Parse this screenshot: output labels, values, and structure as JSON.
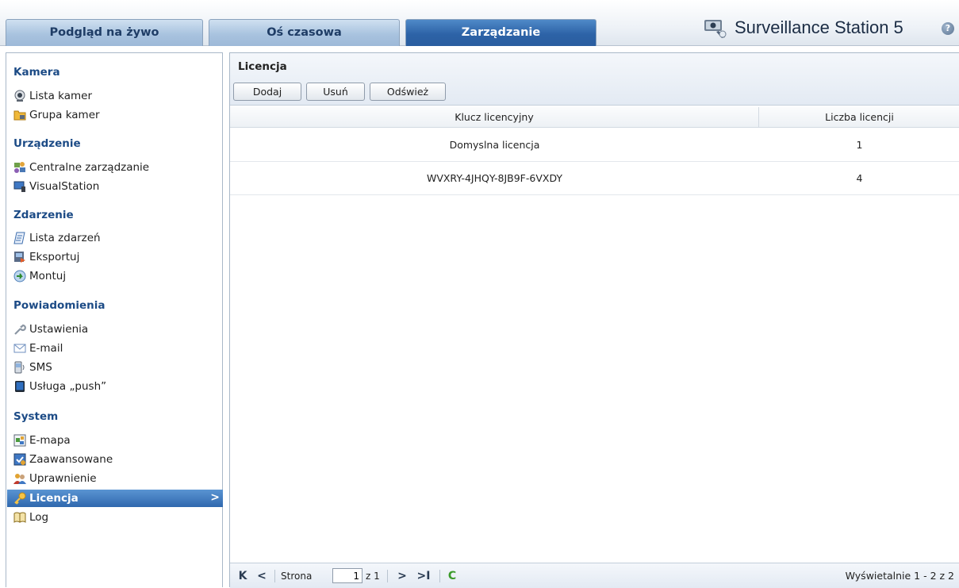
{
  "tabs": [
    {
      "label": "Podgląd na żywo",
      "active": false
    },
    {
      "label": "Oś czasowa",
      "active": false
    },
    {
      "label": "Zarządzanie",
      "active": true
    }
  ],
  "brand": {
    "title": "Surveillance Station 5",
    "logo_icon": "camera-logo-icon",
    "help_icon": "help-icon"
  },
  "sidebar": {
    "sections": [
      {
        "title": "Kamera",
        "items": [
          {
            "label": "Lista kamer",
            "icon": "camera-icon"
          },
          {
            "label": "Grupa kamer",
            "icon": "camera-group-icon"
          }
        ]
      },
      {
        "title": "Urządzenie",
        "items": [
          {
            "label": "Centralne zarządzanie",
            "icon": "central-management-icon"
          },
          {
            "label": "VisualStation",
            "icon": "visualstation-icon"
          }
        ]
      },
      {
        "title": "Zdarzenie",
        "items": [
          {
            "label": "Lista zdarzeń",
            "icon": "event-list-icon"
          },
          {
            "label": "Eksportuj",
            "icon": "export-icon"
          },
          {
            "label": "Montuj",
            "icon": "mount-icon"
          }
        ]
      },
      {
        "title": "Powiadomienia",
        "items": [
          {
            "label": "Ustawienia",
            "icon": "wrench-icon"
          },
          {
            "label": "E-mail",
            "icon": "email-icon"
          },
          {
            "label": "SMS",
            "icon": "sms-icon"
          },
          {
            "label": "Usługa „push”",
            "icon": "push-device-icon"
          }
        ]
      },
      {
        "title": "System",
        "items": [
          {
            "label": "E-mapa",
            "icon": "emap-icon"
          },
          {
            "label": "Zaawansowane",
            "icon": "advanced-icon"
          },
          {
            "label": "Uprawnienie",
            "icon": "privilege-icon"
          },
          {
            "label": "Licencja",
            "icon": "key-icon",
            "selected": true
          },
          {
            "label": "Log",
            "icon": "log-book-icon"
          }
        ]
      }
    ]
  },
  "panel": {
    "title": "Licencja",
    "toolbar": {
      "add": "Dodaj",
      "delete": "Usuń",
      "refresh": "Odśwież"
    },
    "columns": [
      "Klucz licencyjny",
      "Liczba licencji"
    ],
    "rows": [
      {
        "key": "Domyslna licencja",
        "count": "1"
      },
      {
        "key": "WVXRY-4JHQY-8JB9F-6VXDY",
        "count": "4"
      }
    ]
  },
  "pager": {
    "page_label": "Strona",
    "page_value": "1",
    "of_label": "z 1",
    "summary": "Wyświetalnie 1 - 2 z 2",
    "first_icon": "K",
    "prev_icon": "<",
    "next_icon": ">",
    "last_icon": ">I",
    "refresh_icon": "C"
  },
  "colors": {
    "accent": "#2f68ae",
    "section_title": "#1c4b86",
    "refresh_green": "#3b9a2a"
  }
}
